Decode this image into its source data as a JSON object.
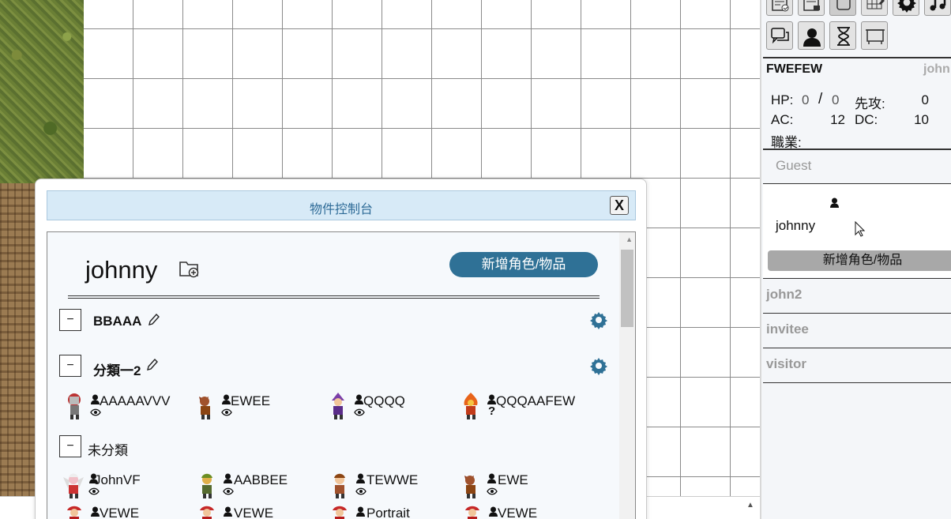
{
  "dialog": {
    "title": "物件控制台",
    "close_label": "X",
    "owner_name": "johnny",
    "add_button_label": "新增角色/物品",
    "groups": [
      {
        "name": "BBAAA",
        "toggle": "−",
        "editable": true,
        "tokens": []
      },
      {
        "name": "分類一2",
        "toggle": "−",
        "editable": true,
        "tokens": [
          {
            "name": "AAAAAVVV",
            "visibility": "eye",
            "sprite": "knight"
          },
          {
            "name": "EWEE",
            "visibility": "eye",
            "sprite": "kobold"
          },
          {
            "name": "QQQQ",
            "visibility": "eye",
            "sprite": "mage"
          },
          {
            "name": "QQQAAFEW",
            "visibility": "?",
            "sprite": "fire"
          }
        ]
      },
      {
        "name": "未分類",
        "toggle": "−",
        "editable": false,
        "tokens": [
          {
            "name": "JohnVF",
            "visibility": "eye",
            "sprite": "angel"
          },
          {
            "name": "AABBEE",
            "visibility": "eye",
            "sprite": "ranger"
          },
          {
            "name": "TEWWE",
            "visibility": "eye",
            "sprite": "fighter"
          },
          {
            "name": "EWE",
            "visibility": "eye",
            "sprite": "kobold"
          },
          {
            "name": "VEWE",
            "visibility": "",
            "sprite": "redcap"
          },
          {
            "name": "VEWE",
            "visibility": "",
            "sprite": "redcap"
          },
          {
            "name": "Portrait",
            "visibility": "",
            "sprite": "redcap"
          },
          {
            "name": "VEWE",
            "visibility": "",
            "sprite": "redcap"
          }
        ]
      }
    ]
  },
  "sidebar": {
    "toolbar_icons": [
      "note-check-icon",
      "note-lock-icon",
      "scroll-icon",
      "grid-edit-icon",
      "gear-icon",
      "music-icon",
      "chat-icon",
      "character-icon",
      "hourglass-icon",
      "screen-icon"
    ],
    "character": {
      "name": "FWEFEW",
      "owner": "john",
      "hp_label": "HP:",
      "hp_current": "0",
      "hp_sep": "/",
      "hp_max": "0",
      "initiative_label": "先攻:",
      "initiative": "0",
      "ac_label": "AC:",
      "ac": "12",
      "dc_label": "DC:",
      "dc": "10",
      "class_label": "職業:"
    },
    "guest_label": "Guest",
    "current_user": "johnny",
    "menu_glyph": "⋮",
    "add_button_label": "新增角色/物品",
    "users": [
      "john2",
      "invitee",
      "visitor"
    ]
  },
  "colors": {
    "accent": "#2f7196",
    "title_bg": "#d7eaf7",
    "title_text": "#2e6b97"
  }
}
